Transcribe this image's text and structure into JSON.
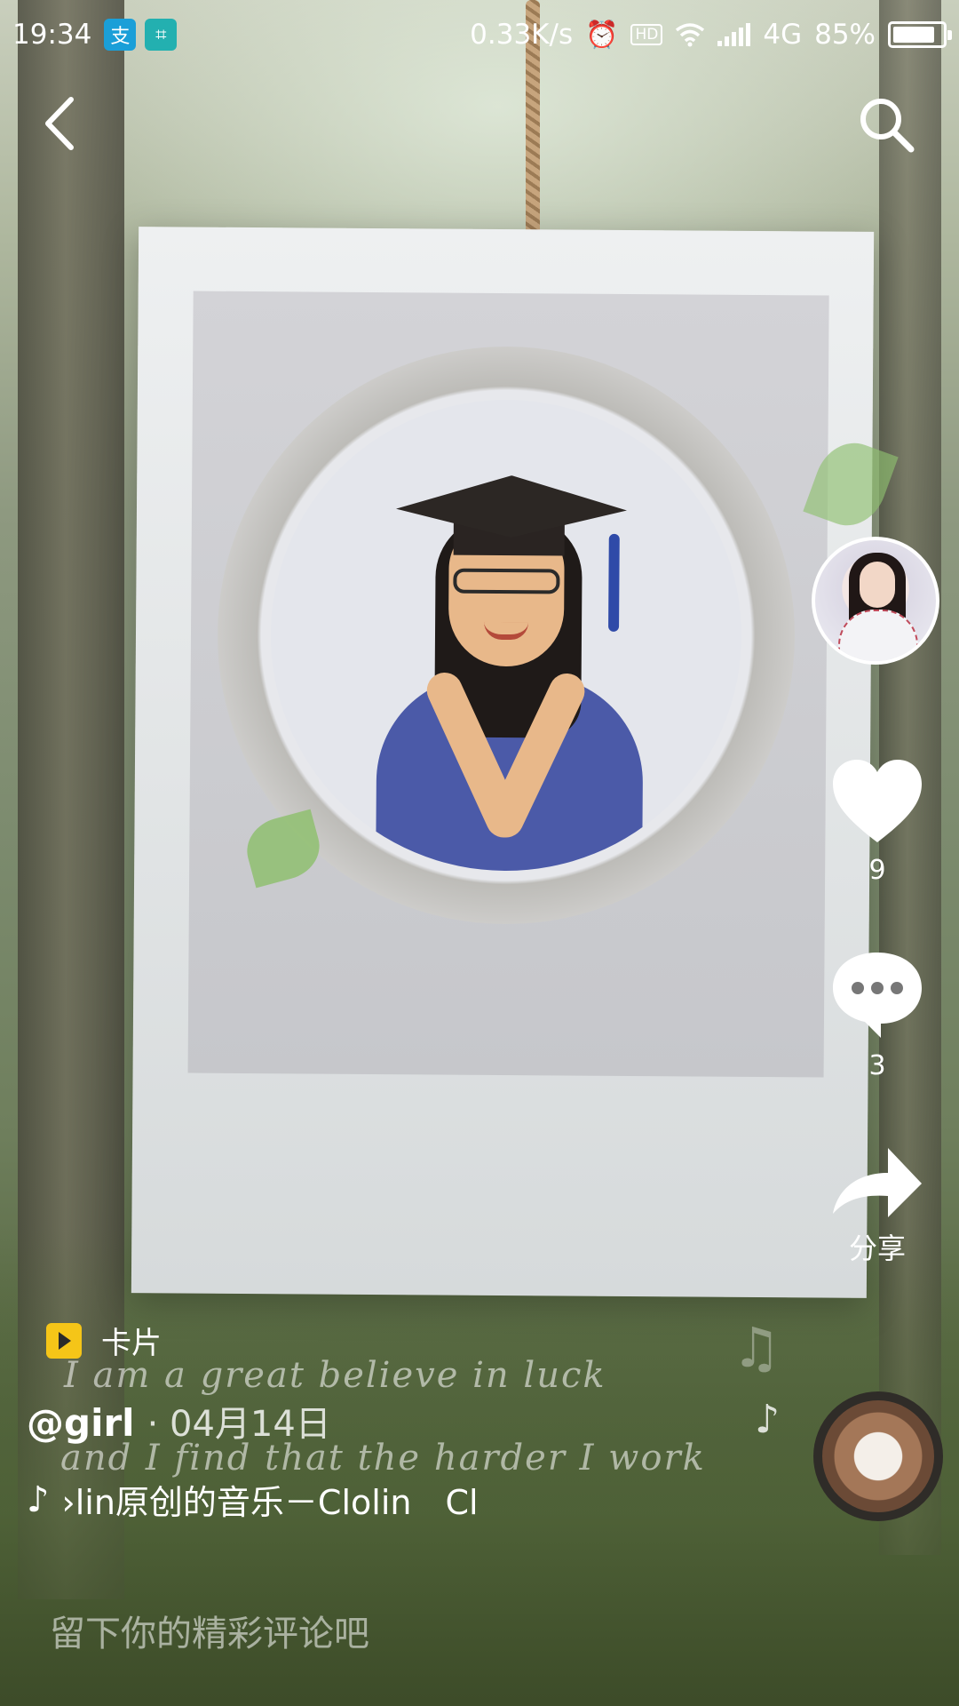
{
  "status_bar": {
    "time": "19:34",
    "net_speed": "0.33K/s",
    "hd": "HD",
    "network": "4G",
    "battery": "85%",
    "battery_level": 0.85,
    "icons": [
      "alipay-icon",
      "scan-icon",
      "alarm-icon",
      "hd-icon",
      "wifi-icon",
      "signal-icon",
      "battery-icon"
    ]
  },
  "nav": {
    "back_icon": "back-icon",
    "search_icon": "search-icon"
  },
  "video": {
    "overlay_lines": [
      "I am a great believe in luck",
      "and I find that the harder I work"
    ]
  },
  "actions": {
    "likes": "9",
    "comments": "3",
    "share_label": "分享"
  },
  "info": {
    "card_label": "卡片",
    "author": "@girl",
    "date": "· 04月14日",
    "music": "›lin原创的音乐－Clolin　Cl"
  },
  "comment": {
    "placeholder": "留下你的精彩评论吧"
  },
  "colors": {
    "accent_card": "#f5c518"
  }
}
